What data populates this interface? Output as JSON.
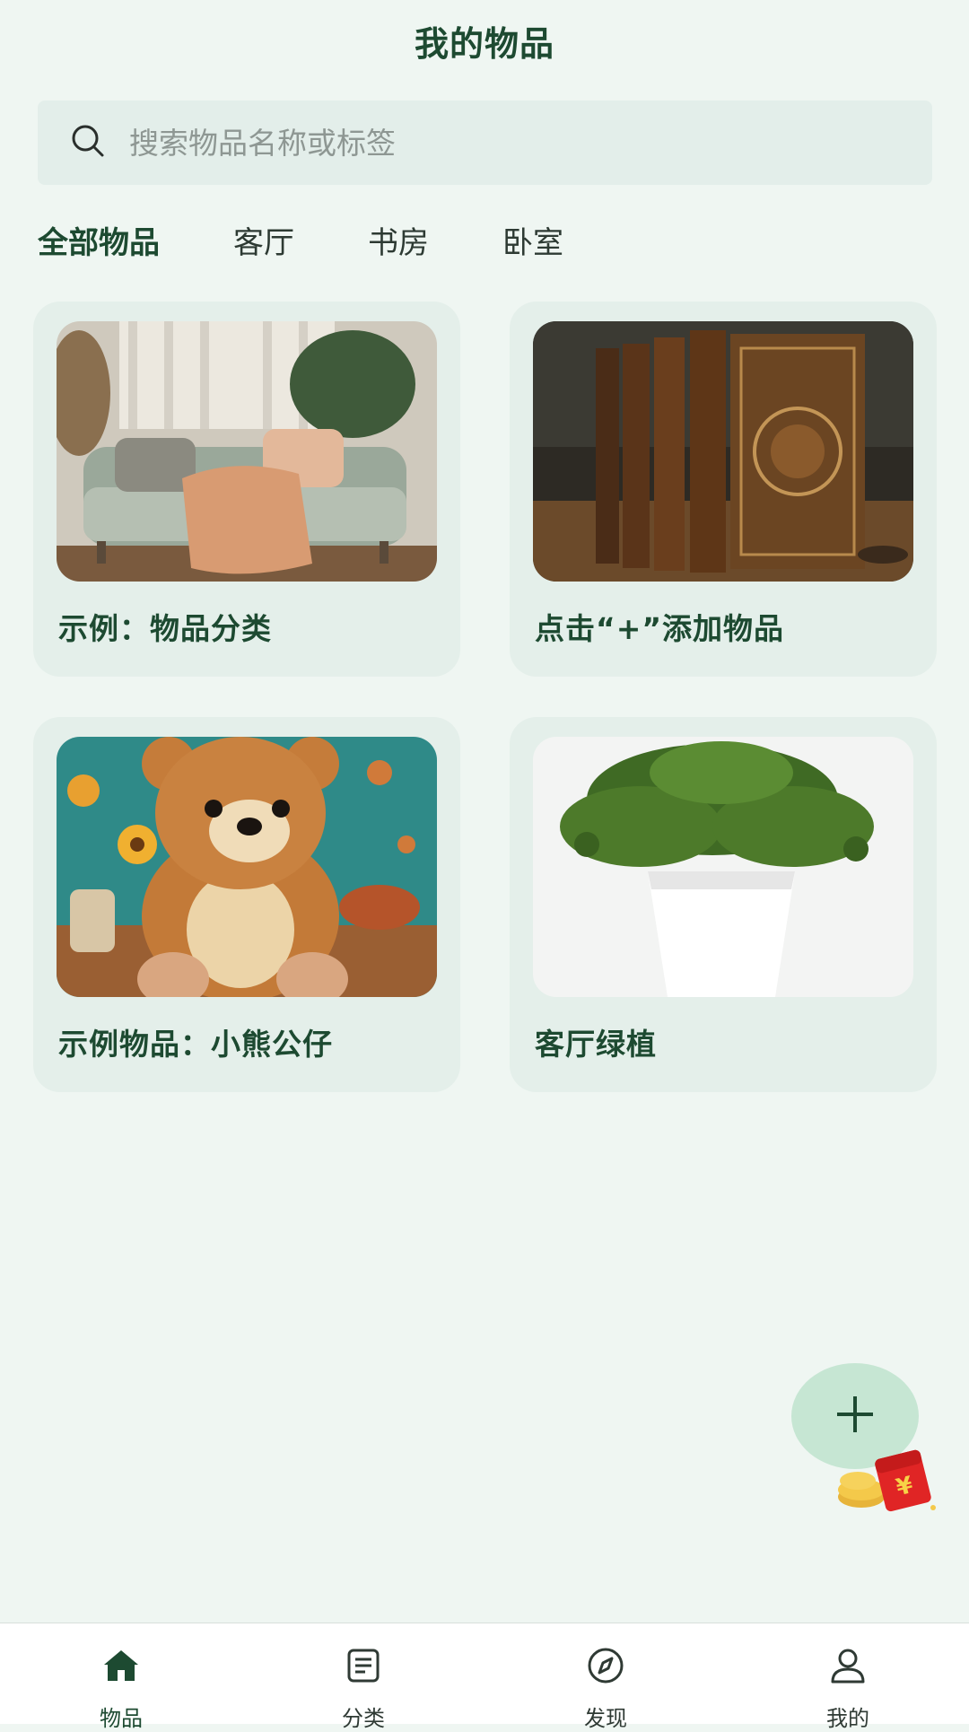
{
  "header": {
    "title": "我的物品"
  },
  "search": {
    "placeholder": "搜索物品名称或标签"
  },
  "tabs": [
    {
      "label": "全部物品",
      "active": true
    },
    {
      "label": "客厅",
      "active": false
    },
    {
      "label": "书房",
      "active": false
    },
    {
      "label": "卧室",
      "active": false
    }
  ],
  "items": [
    {
      "title": "示例：物品分类",
      "image": "sofa-living-room-photo"
    },
    {
      "title": "点击“+”添加物品",
      "image": "old-books-photo"
    },
    {
      "title": "示例物品：小熊公仔",
      "image": "teddy-bear-photo"
    },
    {
      "title": "客厅绿植",
      "image": "potted-plant-photo"
    }
  ],
  "fab": {
    "icon": "plus-icon"
  },
  "promo": {
    "icon": "red-packet-icon",
    "symbol": "¥"
  },
  "bottom_nav": [
    {
      "label": "物品",
      "icon": "home-icon",
      "active": true
    },
    {
      "label": "分类",
      "icon": "list-icon",
      "active": false
    },
    {
      "label": "发现",
      "icon": "compass-icon",
      "active": false
    },
    {
      "label": "我的",
      "icon": "user-icon",
      "active": false
    }
  ],
  "colors": {
    "background": "#eff6f2",
    "primary": "#1d4a31",
    "card": "#e4efea",
    "fab": "#c6e6d3",
    "search_bg": "#e3eeea"
  }
}
